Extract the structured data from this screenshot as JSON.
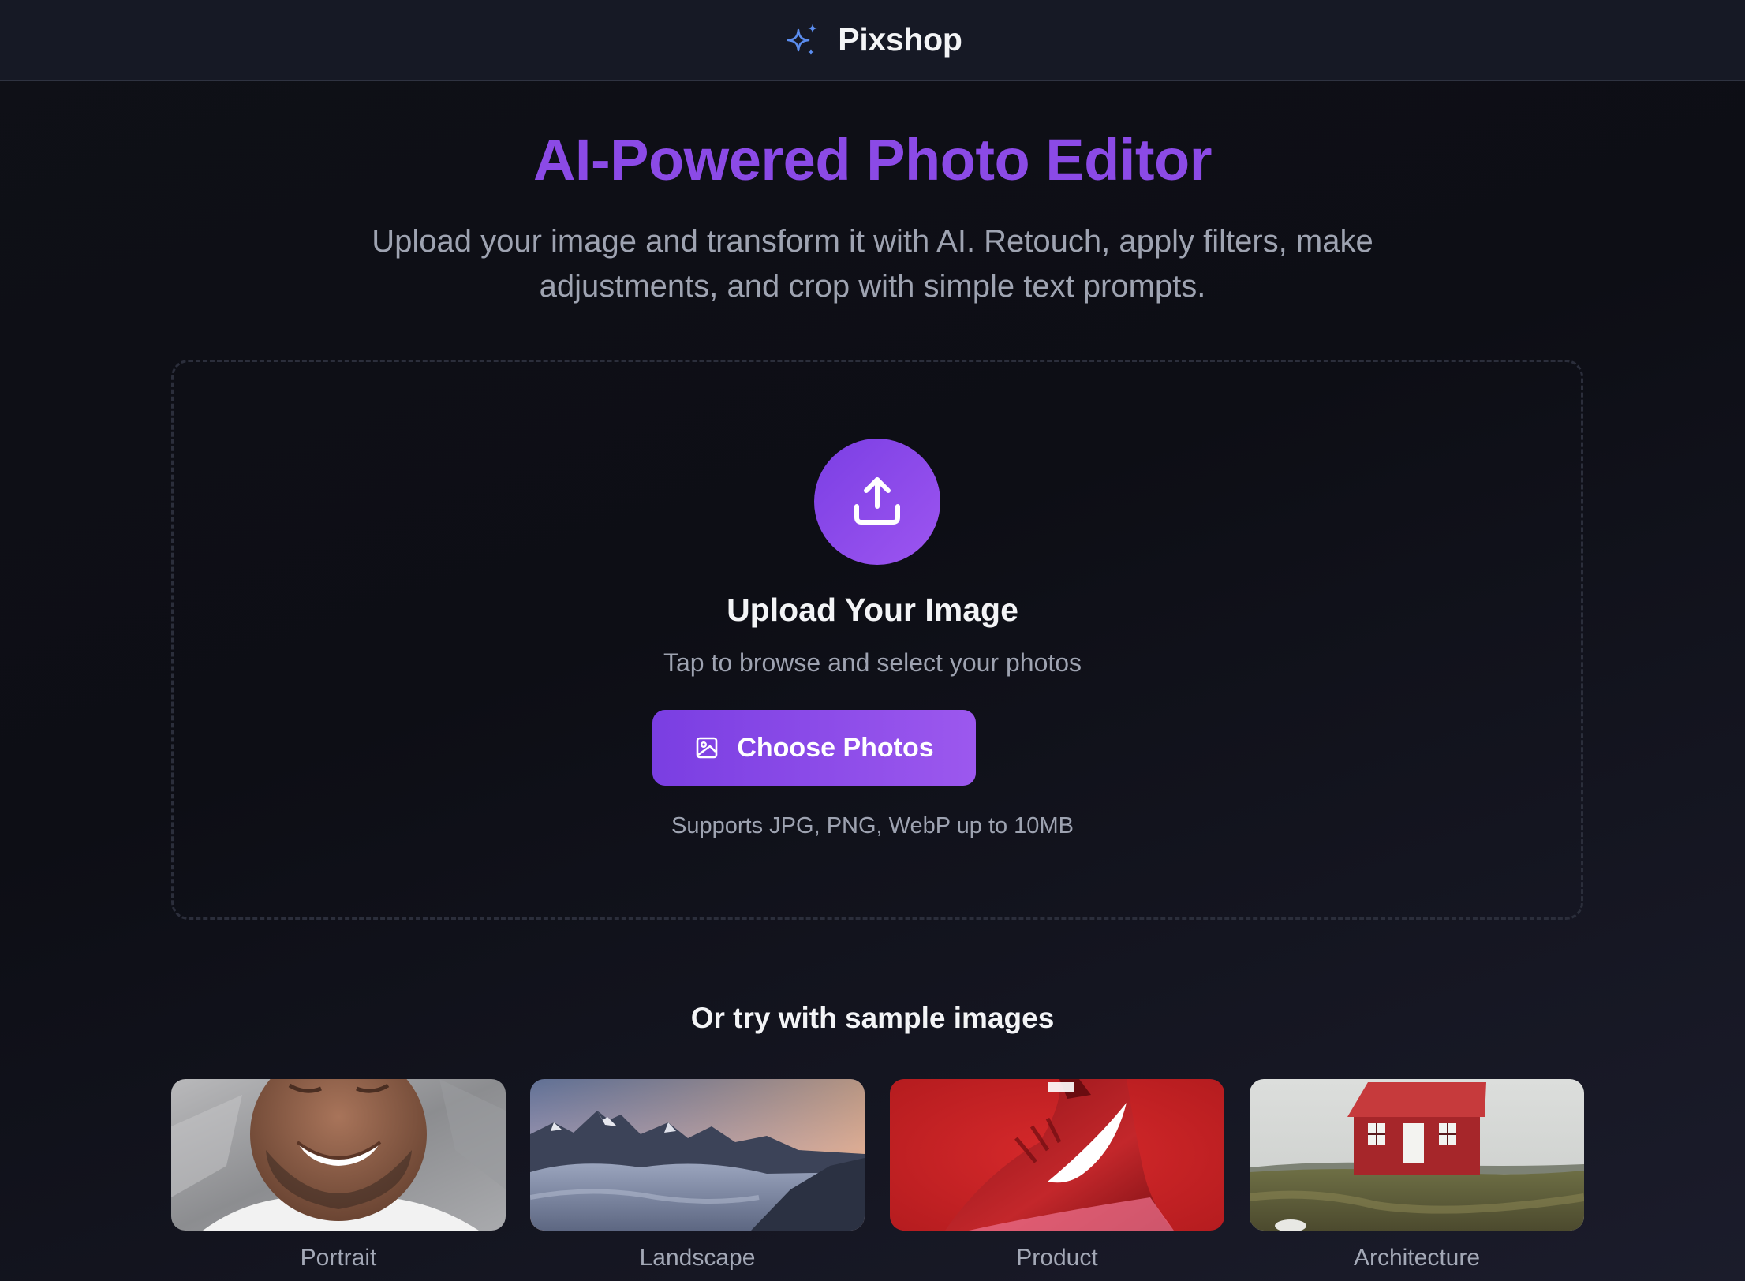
{
  "app": {
    "name": "Pixshop",
    "icon": "sparkles-icon"
  },
  "hero": {
    "title": "AI-Powered Photo Editor",
    "subtitle": "Upload your image and transform it with AI. Retouch, apply filters, make adjustments, and crop with simple text prompts."
  },
  "upload": {
    "icon": "upload-icon",
    "title": "Upload Your Image",
    "subtitle": "Tap to browse and select your photos",
    "button_label": "Choose Photos",
    "button_icon": "image-icon",
    "supports": "Supports JPG, PNG, WebP up to 10MB"
  },
  "samples": {
    "title": "Or try with sample images",
    "items": [
      {
        "label": "Portrait"
      },
      {
        "label": "Landscape"
      },
      {
        "label": "Product"
      },
      {
        "label": "Architecture"
      }
    ]
  },
  "colors": {
    "accent": "#8b4ae6",
    "button_gradient_start": "#7a3ee2",
    "button_gradient_end": "#9c58ee",
    "header_bg": "#161925",
    "muted_text": "#9ea3b1"
  }
}
